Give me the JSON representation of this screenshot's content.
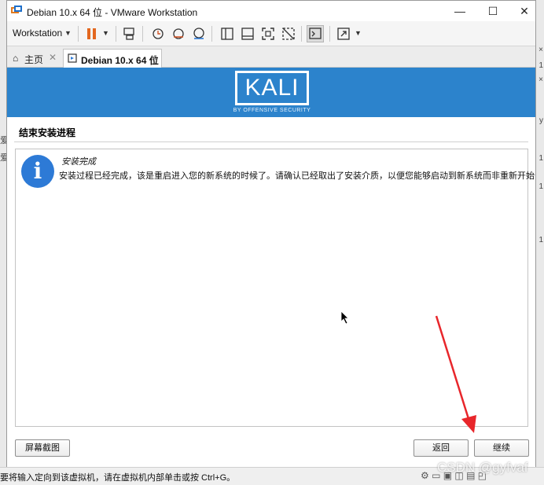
{
  "window": {
    "title": "Debian 10.x 64 位 - VMware Workstation"
  },
  "toolbar": {
    "workstation_label": "Workstation"
  },
  "tabs": [
    {
      "label": "主页"
    },
    {
      "label": "Debian 10.x 64 位"
    }
  ],
  "banner": {
    "logo_text": "KALI",
    "logo_subtitle": "BY OFFENSIVE SECURITY"
  },
  "installer": {
    "heading": "结束安装进程",
    "message_title": "安装完成",
    "message_body": "安装过程已经完成，该是重启进入您的新系统的时候了。请确认已经取出了安装介质，以便您能够启动到新系统而非重新开始安装。",
    "screenshot_button": "屏幕截图",
    "back_button": "返回",
    "continue_button": "继续"
  },
  "statusbar": {
    "text": "要将输入定向到该虚拟机，请在虚拟机内部单击或按 Ctrl+G。"
  },
  "watermark": {
    "text": "CSDN @gyfvaf"
  },
  "colors": {
    "banner": "#2c83cc",
    "accent_orange": "#e3671f",
    "info_blue": "#2d7ad6",
    "arrow_red": "#e8262b"
  },
  "icons": [
    "vmware-app-icon",
    "minimize-icon",
    "maximize-icon",
    "close-icon",
    "pause-icon",
    "send-ctrl-alt-del-icon",
    "snapshot-icon",
    "revert-snapshot-icon",
    "snapshot-manager-icon",
    "sidebar-view-icon",
    "console-view-icon",
    "fullscreen-icon",
    "unity-icon",
    "terminal-icon",
    "stretch-icon",
    "home-icon",
    "vm-tab-icon",
    "info-icon"
  ]
}
